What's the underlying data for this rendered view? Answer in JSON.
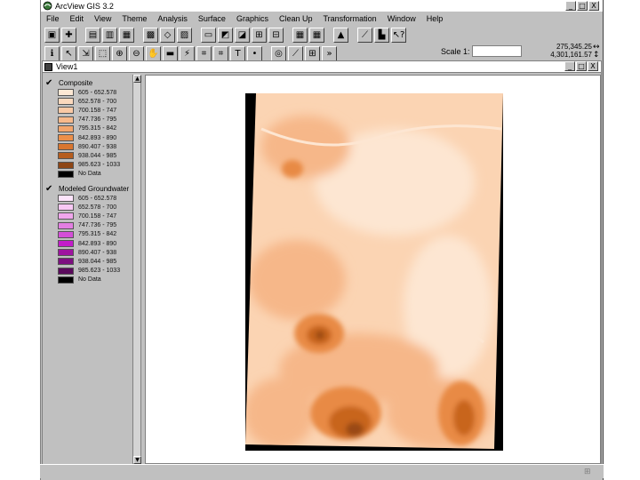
{
  "window": {
    "title": "ArcView GIS 3.2",
    "min": "_",
    "max": "□",
    "close": "X"
  },
  "menus": [
    "File",
    "Edit",
    "View",
    "Theme",
    "Analysis",
    "Surface",
    "Graphics",
    "Clean Up",
    "Transformation",
    "Window",
    "Help"
  ],
  "toolbar1": [
    {
      "icon": "save-icon",
      "glyph": "▣"
    },
    {
      "icon": "add-theme-icon",
      "glyph": "✚"
    },
    {
      "icon": "theme-properties-icon",
      "glyph": "▤",
      "gap": true
    },
    {
      "icon": "edit-legend-icon",
      "glyph": "▥"
    },
    {
      "icon": "open-table-icon",
      "glyph": "▦"
    },
    {
      "icon": "find-icon",
      "glyph": "▩",
      "gap": true
    },
    {
      "icon": "locate-icon",
      "glyph": "◇"
    },
    {
      "icon": "query-icon",
      "glyph": "▨"
    },
    {
      "icon": "zoom-to-extent-icon",
      "glyph": "▭",
      "gap": true
    },
    {
      "icon": "zoom-to-themes-icon",
      "glyph": "◩"
    },
    {
      "icon": "zoom-to-selected-icon",
      "glyph": "◪"
    },
    {
      "icon": "zoom-in-icon",
      "glyph": "⊞"
    },
    {
      "icon": "zoom-out-icon",
      "glyph": "⊟"
    },
    {
      "icon": "zoom-previous-icon",
      "glyph": "▦",
      "gap": true
    },
    {
      "icon": "select-features-icon",
      "glyph": "▦"
    },
    {
      "icon": "clear-selection-icon",
      "glyph": "▲",
      "gap": true
    },
    {
      "icon": "measure-icon",
      "glyph": "⟋",
      "gap": true
    },
    {
      "icon": "layout-icon",
      "glyph": "▙"
    },
    {
      "icon": "help-icon",
      "glyph": "↖?"
    }
  ],
  "toolbar2": [
    {
      "icon": "identify-icon",
      "glyph": "ℹ"
    },
    {
      "icon": "pointer-icon",
      "glyph": "↖"
    },
    {
      "icon": "vertex-edit-icon",
      "glyph": "⇲"
    },
    {
      "icon": "select-feature-icon",
      "glyph": "⬚"
    },
    {
      "icon": "zoom-in-tool-icon",
      "glyph": "⊕"
    },
    {
      "icon": "zoom-out-tool-icon",
      "glyph": "⊖"
    },
    {
      "icon": "pan-icon",
      "glyph": "✋"
    },
    {
      "icon": "measure-tool-icon",
      "glyph": "▬"
    },
    {
      "icon": "hotlink-icon",
      "glyph": "⚡"
    },
    {
      "icon": "area-of-interest-icon",
      "glyph": "⌗"
    },
    {
      "icon": "label-icon",
      "glyph": "⌗"
    },
    {
      "icon": "text-tool-icon",
      "glyph": "T"
    },
    {
      "icon": "draw-point-icon",
      "glyph": "•"
    },
    {
      "icon": "contour-tool-icon",
      "glyph": "◎",
      "gap": true
    },
    {
      "icon": "profile-tool-icon",
      "glyph": "⟋"
    },
    {
      "icon": "sketch-tool-icon",
      "glyph": "⊞"
    },
    {
      "icon": "snap-tool-icon",
      "glyph": "»"
    }
  ],
  "scale": {
    "label": "Scale 1:",
    "value": ""
  },
  "coords": {
    "x": "275,345.25",
    "y": "4,301,161.57"
  },
  "view": {
    "title": "View1"
  },
  "themes": [
    {
      "name": "Composite",
      "checked": true,
      "classes": [
        {
          "label": "605 - 652.578",
          "color": "#fde8d4"
        },
        {
          "label": "652.578 - 700",
          "color": "#fbd9bd"
        },
        {
          "label": "700.158 - 747",
          "color": "#f9c9a5"
        },
        {
          "label": "747.736 - 795",
          "color": "#f7b98b"
        },
        {
          "label": "795.315 - 842",
          "color": "#f3a56c"
        },
        {
          "label": "842.893 - 890",
          "color": "#ec8f4a"
        },
        {
          "label": "890.407 - 938",
          "color": "#d9762f"
        },
        {
          "label": "938.044 - 985",
          "color": "#b65d1f"
        },
        {
          "label": "985.623 - 1033",
          "color": "#8e4616"
        },
        {
          "label": "No Data",
          "color": "#000000"
        }
      ]
    },
    {
      "name": "Modeled Groundwater",
      "checked": true,
      "classes": [
        {
          "label": "605 - 652.578",
          "color": "#fde4fb"
        },
        {
          "label": "652.578 - 700",
          "color": "#f8c8f4"
        },
        {
          "label": "700.158 - 747",
          "color": "#f0a6ec"
        },
        {
          "label": "747.736 - 795",
          "color": "#e37fe2"
        },
        {
          "label": "795.315 - 842",
          "color": "#d44fd8"
        },
        {
          "label": "842.893 - 890",
          "color": "#c21cc9"
        },
        {
          "label": "890.407 - 938",
          "color": "#9e139f"
        },
        {
          "label": "938.044 - 985",
          "color": "#7d0f80"
        },
        {
          "label": "985.623 - 1033",
          "color": "#5a0a5c"
        },
        {
          "label": "No Data",
          "color": "#000000"
        }
      ]
    }
  ],
  "raster_colors": {
    "base": "#fbd4b3",
    "light": "#fde6d2",
    "mid": "#f6b789",
    "dark": "#e88a45",
    "darker": "#c8651f",
    "darkest": "#9a4a12",
    "frame": "#000000"
  }
}
